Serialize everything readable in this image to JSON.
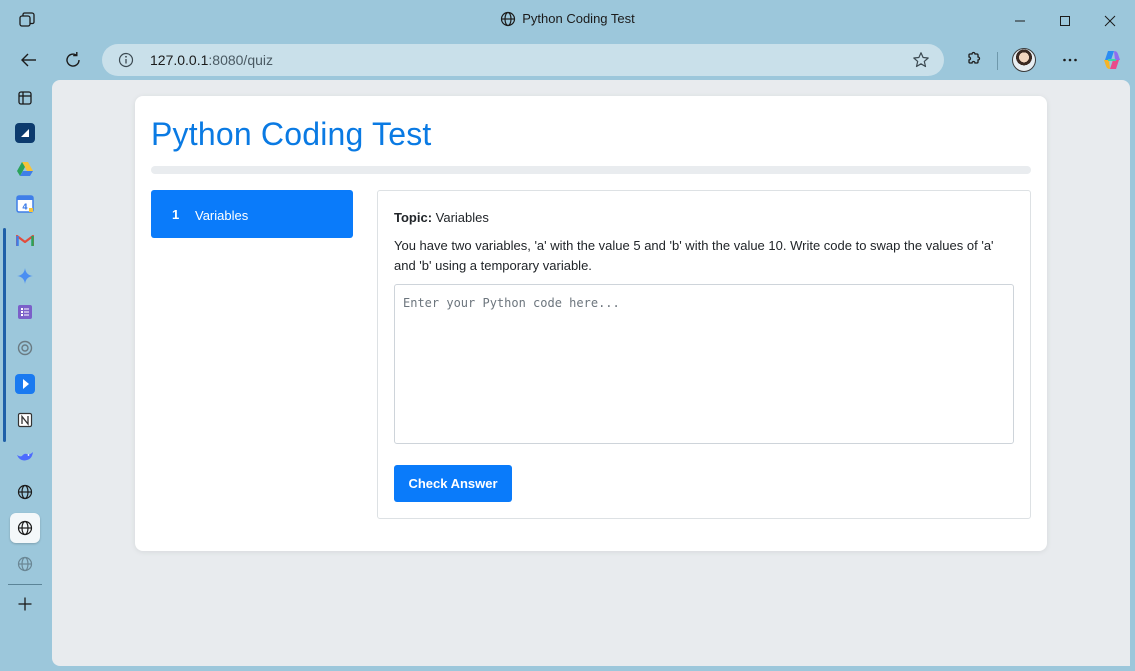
{
  "window": {
    "title": "Python Coding Test",
    "controls": [
      "minimize-icon",
      "maximize-icon",
      "close-icon"
    ]
  },
  "toolbar": {
    "url_host": "127.0.0.1",
    "url_path": ":8080/quiz",
    "icons": [
      "back-icon",
      "refresh-icon",
      "info-icon",
      "favorite-star-icon",
      "extensions-icon",
      "avatar",
      "more-icon",
      "copilot-icon"
    ]
  },
  "sidebar": {
    "items": [
      {
        "icon": "tab-actions-icon"
      },
      {
        "icon": "sidebar-app-icon"
      },
      {
        "icon": "drive-icon"
      },
      {
        "icon": "calendar-icon"
      },
      {
        "icon": "gmail-icon"
      },
      {
        "icon": "gemini-icon"
      },
      {
        "icon": "forms-icon"
      },
      {
        "icon": "chatgpt-icon"
      },
      {
        "icon": "media-player-icon"
      },
      {
        "icon": "notion-icon"
      },
      {
        "icon": "deepseek-icon"
      },
      {
        "icon": "globe-icon"
      },
      {
        "icon": "globe-icon-active"
      },
      {
        "icon": "globe-icon-faded"
      },
      {
        "icon": "add-icon"
      }
    ]
  },
  "page": {
    "title": "Python Coding Test",
    "progress_fraction": 0,
    "nav": [
      {
        "number": "1",
        "label": "Variables"
      }
    ],
    "question": {
      "topic_label": "Topic:",
      "topic_value": "Variables",
      "text": "You have two variables, 'a' with the value 5 and 'b' with the value 10. Write code to swap the values of 'a' and 'b' using a temporary variable.",
      "code_placeholder": "Enter your Python code here...",
      "code_value": "",
      "check_label": "Check Answer"
    }
  },
  "colors": {
    "accent": "#0a7bfa",
    "title": "#0a7ae3",
    "chrome": "#9cc7db"
  }
}
